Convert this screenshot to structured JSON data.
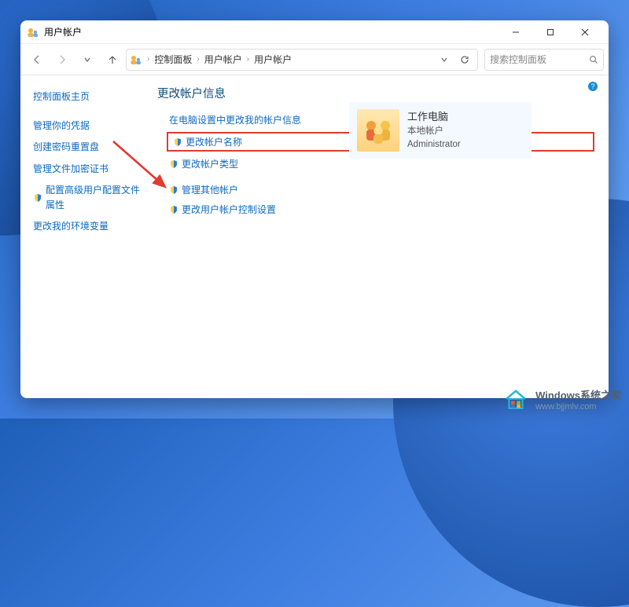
{
  "window": {
    "title": "用户帐户",
    "controls": {
      "minimize": "—",
      "maximize": "▢",
      "close": "✕"
    }
  },
  "breadcrumb": {
    "items": [
      "控制面板",
      "用户帐户",
      "用户帐户"
    ]
  },
  "search": {
    "placeholder": "搜索控制面板"
  },
  "sidebar": {
    "home": "控制面板主页",
    "links": [
      "管理你的凭据",
      "创建密码重置盘",
      "管理文件加密证书",
      "配置高级用户配置文件属性",
      "更改我的环境变量"
    ]
  },
  "main": {
    "heading": "更改帐户信息",
    "links_primary": [
      "在电脑设置中更改我的帐户信息",
      "更改帐户名称",
      "更改帐户类型"
    ],
    "links_secondary": [
      "管理其他帐户",
      "更改用户帐户控制设置"
    ],
    "boxed_index": 1
  },
  "account": {
    "name": "工作电脑",
    "type": "本地帐户",
    "role": "Administrator"
  },
  "help_tooltip": "?",
  "watermark": {
    "brand": "Windows系统之家",
    "url": "www.bjjmlv.com"
  }
}
